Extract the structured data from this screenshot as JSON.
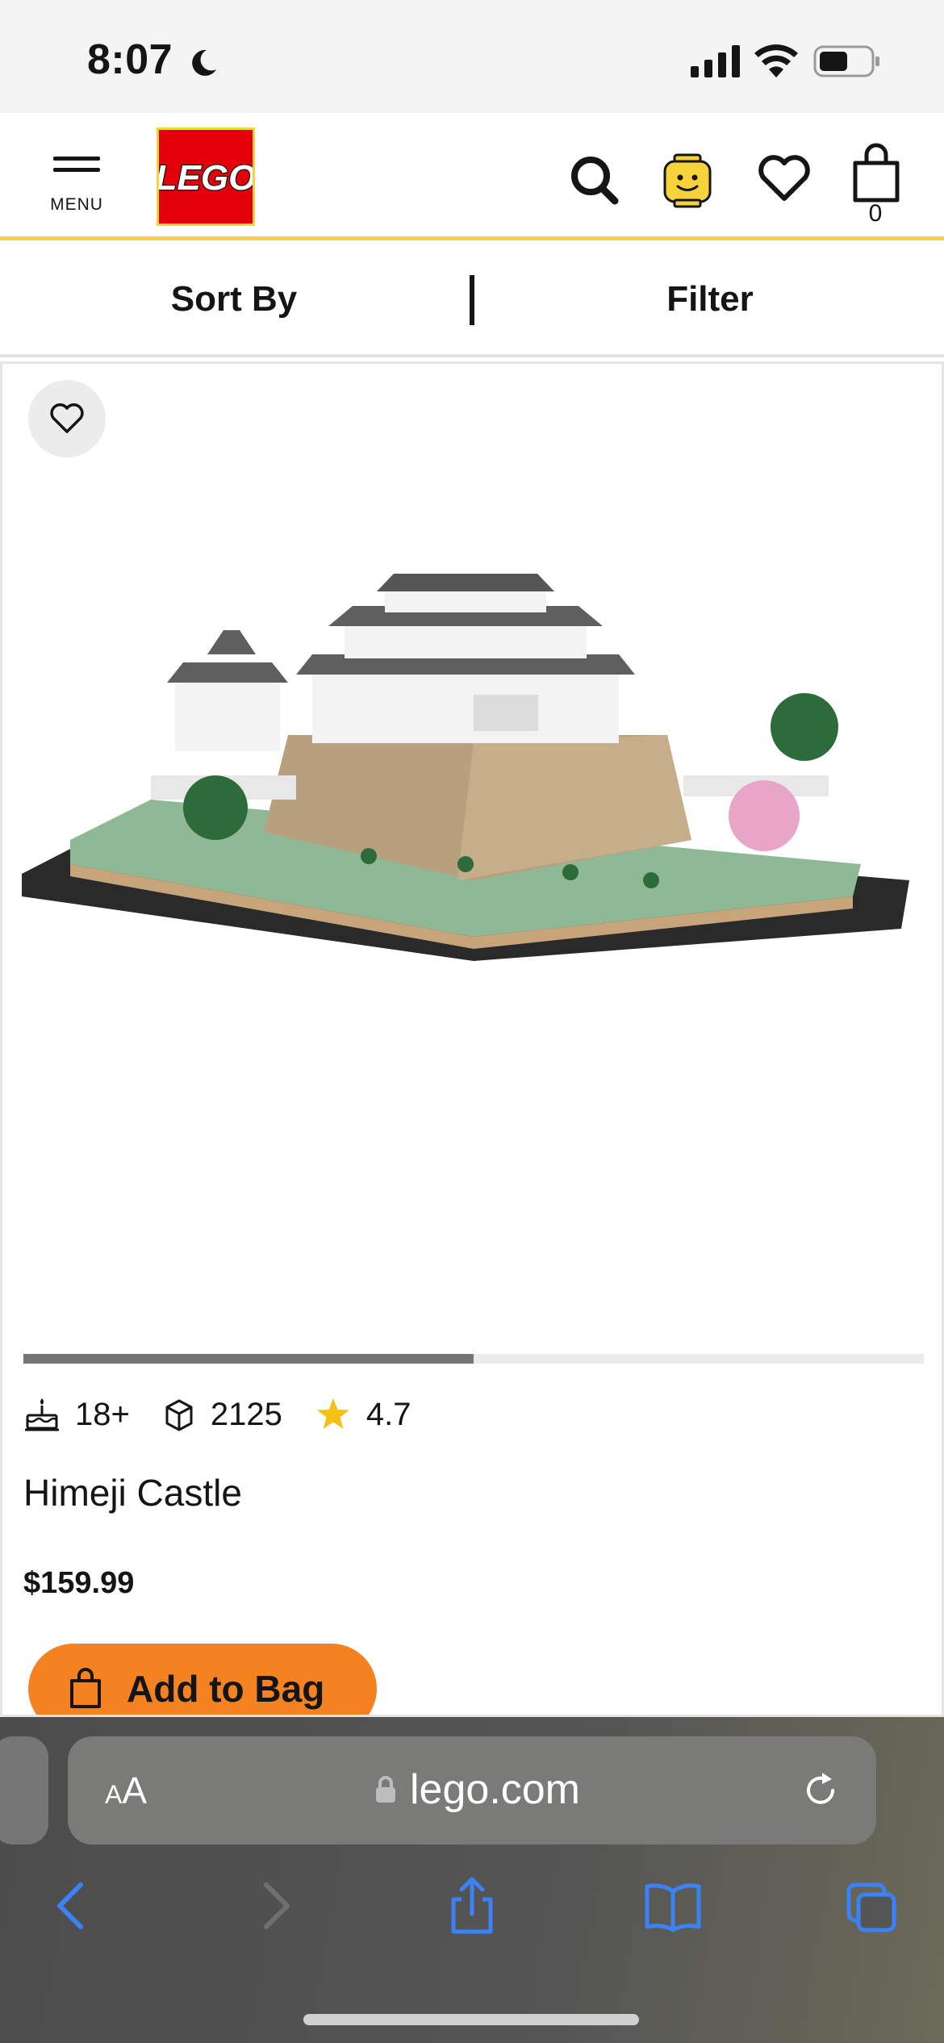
{
  "status_bar": {
    "time": "8:07"
  },
  "header": {
    "menu_label": "MENU",
    "logo_text": "LEGO",
    "cart_count": "0",
    "accent_color": "#f6d33b"
  },
  "toolbar": {
    "sort_label": "Sort By",
    "filter_label": "Filter"
  },
  "product": {
    "age": "18+",
    "pieces": "2125",
    "rating": "4.7",
    "title": "Himeji Castle",
    "price": "$159.99",
    "add_to_bag_label": "Add to Bag",
    "carousel_progress": 0.5
  },
  "browser": {
    "text_size_label_small": "A",
    "text_size_label_large": "A",
    "url": "lego.com"
  }
}
